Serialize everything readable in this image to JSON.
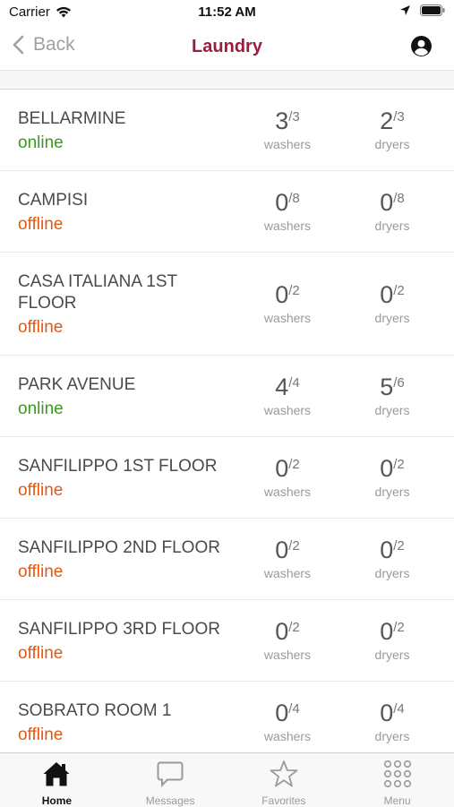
{
  "status_bar": {
    "carrier": "Carrier",
    "time": "11:52 AM"
  },
  "nav": {
    "back_label": "Back",
    "title": "Laundry"
  },
  "labels": {
    "washers": "washers",
    "dryers": "dryers"
  },
  "locations": [
    {
      "name": "BELLARMINE",
      "status": "online",
      "washers": "3",
      "washers_total": "/3",
      "dryers": "2",
      "dryers_total": "/3"
    },
    {
      "name": "CAMPISI",
      "status": "offline",
      "washers": "0",
      "washers_total": "/8",
      "dryers": "0",
      "dryers_total": "/8"
    },
    {
      "name": "CASA ITALIANA 1ST FLOOR",
      "status": "offline",
      "washers": "0",
      "washers_total": "/2",
      "dryers": "0",
      "dryers_total": "/2"
    },
    {
      "name": "PARK AVENUE",
      "status": "online",
      "washers": "4",
      "washers_total": "/4",
      "dryers": "5",
      "dryers_total": "/6"
    },
    {
      "name": "SANFILIPPO 1ST FLOOR",
      "status": "offline",
      "washers": "0",
      "washers_total": "/2",
      "dryers": "0",
      "dryers_total": "/2"
    },
    {
      "name": "SANFILIPPO 2ND FLOOR",
      "status": "offline",
      "washers": "0",
      "washers_total": "/2",
      "dryers": "0",
      "dryers_total": "/2"
    },
    {
      "name": "SANFILIPPO 3RD FLOOR",
      "status": "offline",
      "washers": "0",
      "washers_total": "/2",
      "dryers": "0",
      "dryers_total": "/2"
    },
    {
      "name": "SOBRATO ROOM 1",
      "status": "offline",
      "washers": "0",
      "washers_total": "/4",
      "dryers": "0",
      "dryers_total": "/4"
    }
  ],
  "tabs": [
    {
      "label": "Home",
      "icon": "home-icon",
      "active": true
    },
    {
      "label": "Messages",
      "icon": "chat-icon",
      "active": false
    },
    {
      "label": "Favorites",
      "icon": "star-icon",
      "active": false
    },
    {
      "label": "Menu",
      "icon": "grid-icon",
      "active": false
    }
  ],
  "colors": {
    "title": "#9b1d3f",
    "online": "#3b9a1e",
    "offline": "#e05a14"
  }
}
